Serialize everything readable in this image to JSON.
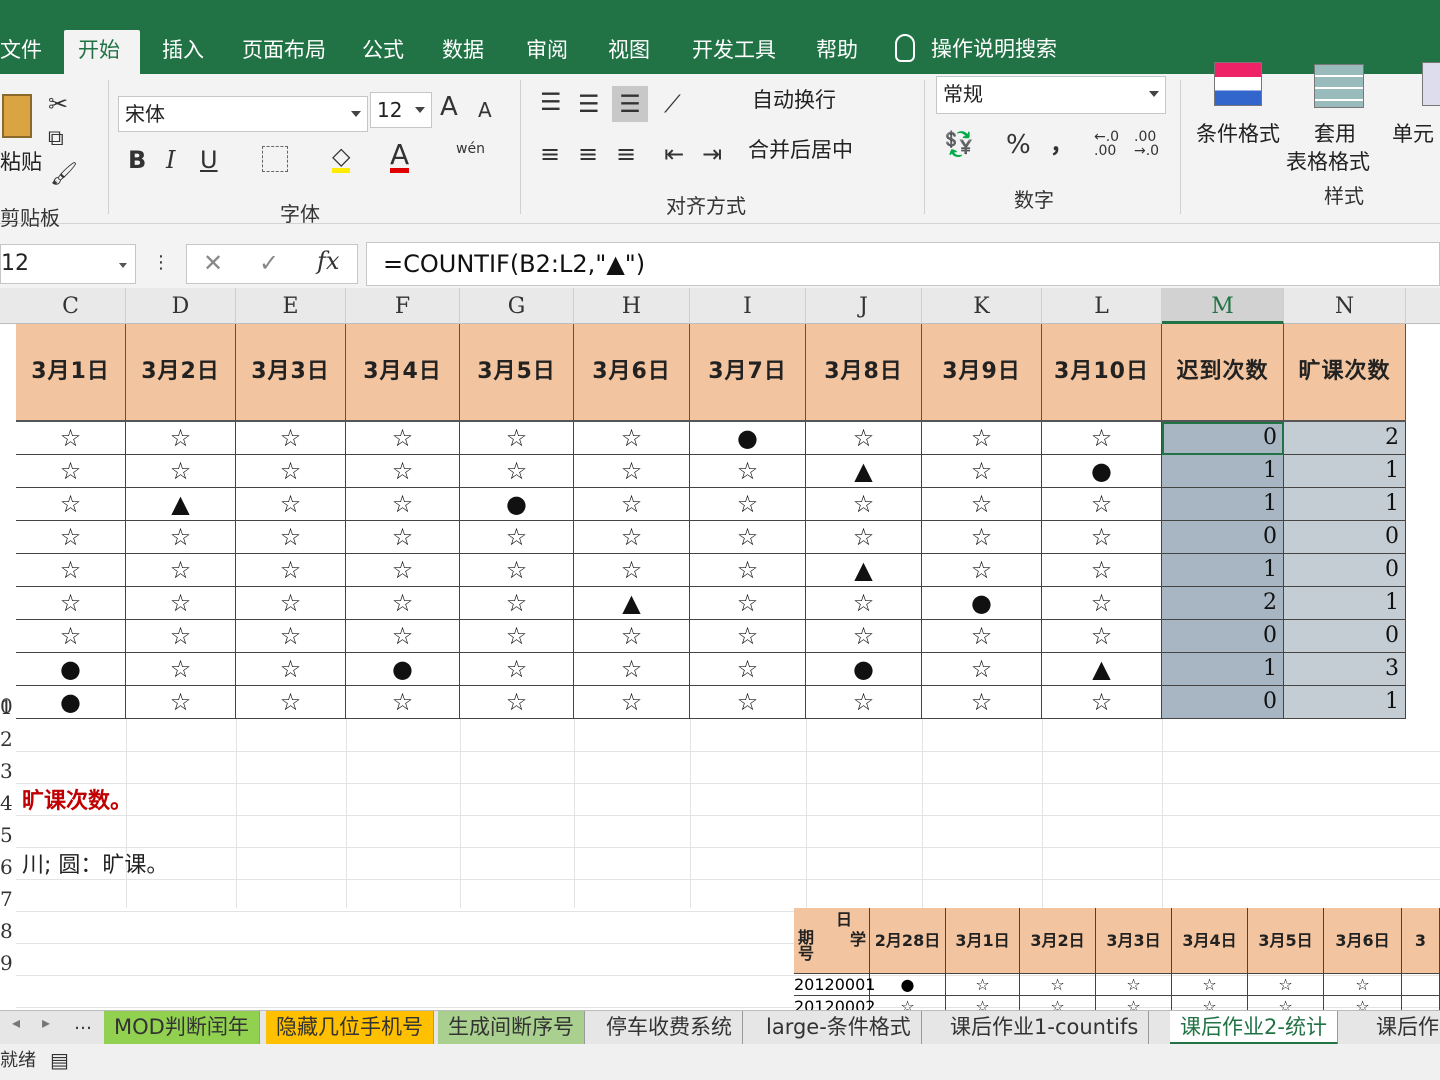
{
  "menu": {
    "tabs": [
      "文件",
      "开始",
      "插入",
      "页面布局",
      "公式",
      "数据",
      "审阅",
      "视图",
      "开发工具",
      "帮助"
    ],
    "search": "操作说明搜索"
  },
  "ribbon": {
    "clipboard": {
      "paste": "粘贴",
      "label": "剪贴板"
    },
    "font": {
      "name": "宋体",
      "size": "12",
      "bold": "B",
      "italic": "I",
      "underline": "U",
      "wen": "wén",
      "label": "字体"
    },
    "alignment": {
      "wrap": "自动换行",
      "merge": "合并后居中",
      "label": "对齐方式"
    },
    "number": {
      "format": "常规",
      "percent": "%",
      "comma": "，",
      "inc": "←.0 .00",
      "dec": ".00 →.0",
      "label": "数字"
    },
    "styles": {
      "conditional": "条件格式",
      "table_fmt_1": "套用",
      "table_fmt_2": "表格格式",
      "cell": "单元",
      "label": "样式"
    }
  },
  "formula_bar": {
    "name_box": "12",
    "formula": "=COUNTIF(B2:L2,\"▲\")"
  },
  "columns": [
    "C",
    "D",
    "E",
    "F",
    "G",
    "H",
    "I",
    "J",
    "K",
    "L",
    "M",
    "N"
  ],
  "header_row": [
    "3月1日",
    "3月2日",
    "3月3日",
    "3月4日",
    "3月5日",
    "3月6日",
    "3月7日",
    "3月8日",
    "3月9日",
    "3月10日",
    "迟到次数",
    "旷课次数"
  ],
  "rows": [
    [
      "☆",
      "☆",
      "☆",
      "☆",
      "☆",
      "☆",
      "●",
      "☆",
      "☆",
      "☆",
      "0",
      "2"
    ],
    [
      "☆",
      "☆",
      "☆",
      "☆",
      "☆",
      "☆",
      "☆",
      "▲",
      "☆",
      "●",
      "1",
      "1"
    ],
    [
      "☆",
      "▲",
      "☆",
      "☆",
      "●",
      "☆",
      "☆",
      "☆",
      "☆",
      "☆",
      "1",
      "1"
    ],
    [
      "☆",
      "☆",
      "☆",
      "☆",
      "☆",
      "☆",
      "☆",
      "☆",
      "☆",
      "☆",
      "0",
      "0"
    ],
    [
      "☆",
      "☆",
      "☆",
      "☆",
      "☆",
      "☆",
      "☆",
      "▲",
      "☆",
      "☆",
      "1",
      "0"
    ],
    [
      "☆",
      "☆",
      "☆",
      "☆",
      "☆",
      "▲",
      "☆",
      "☆",
      "●",
      "☆",
      "2",
      "1"
    ],
    [
      "☆",
      "☆",
      "☆",
      "☆",
      "☆",
      "☆",
      "☆",
      "☆",
      "☆",
      "☆",
      "0",
      "0"
    ],
    [
      "●",
      "☆",
      "☆",
      "●",
      "☆",
      "☆",
      "☆",
      "●",
      "☆",
      "▲",
      "1",
      "3"
    ],
    [
      "●",
      "☆",
      "☆",
      "☆",
      "☆",
      "☆",
      "☆",
      "☆",
      "☆",
      "☆",
      "0",
      "1"
    ]
  ],
  "row_numbers": [
    "",
    "",
    "",
    "",
    "",
    "",
    "",
    "",
    "",
    "0",
    "1",
    "2",
    "3",
    "4",
    "5",
    "6",
    "7",
    "8",
    "9"
  ],
  "notes": {
    "line1": "旷课次数。",
    "line2": "川;  圆：旷课。"
  },
  "mini_table": {
    "corner_top": "日",
    "corner_mid": "学",
    "corner_bottom": "期号",
    "dates": [
      "2月28日",
      "3月1日",
      "3月2日",
      "3月3日",
      "3月4日",
      "3月5日",
      "3月6日",
      "3"
    ],
    "rows": [
      {
        "id": "20120001",
        "marks": [
          "●",
          "☆",
          "☆",
          "☆",
          "☆",
          "☆",
          "☆",
          ""
        ]
      },
      {
        "id": "20120002",
        "marks": [
          "☆",
          "☆",
          "☆",
          "☆",
          "☆",
          "☆",
          "☆",
          ""
        ]
      }
    ]
  },
  "sheet_tabs": [
    "MOD判断闰年",
    "隐藏几位手机号",
    "生成间断序号",
    "停车收费系统",
    "large-条件格式",
    "课后作业1-countifs",
    "课后作业2-统计",
    "课后作"
  ],
  "tab_colors": {
    "MOD判断闰年": "#92d050",
    "隐藏几位手机号": "#ffc000",
    "生成间断序号": "#a9d08e"
  },
  "status": "就绪",
  "colors": {
    "excel_green": "#217346",
    "header_fill": "#f2c49f",
    "note_red": "#c00000"
  }
}
